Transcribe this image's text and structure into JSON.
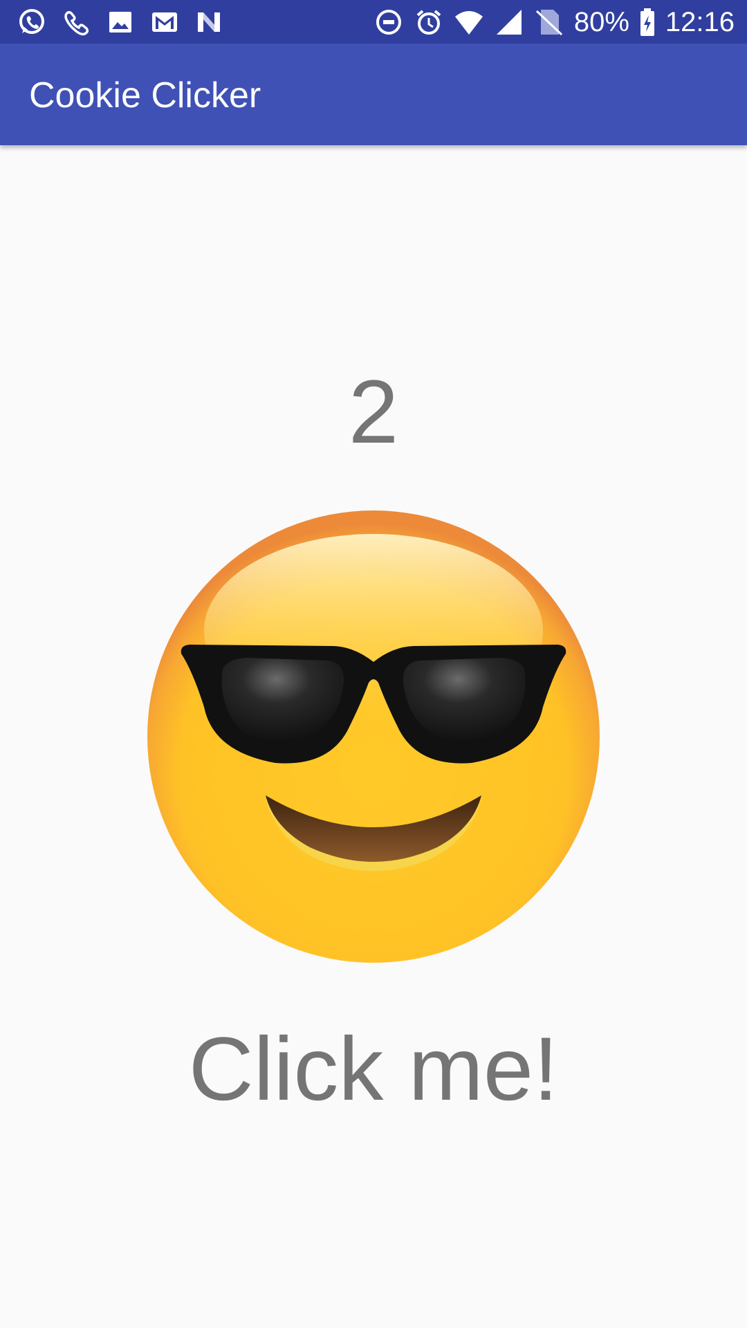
{
  "status_bar": {
    "battery": "80%",
    "time": "12:16",
    "left_icons": [
      "whatsapp-icon",
      "phone-icon",
      "image-icon",
      "gmail-icon",
      "n-app-icon"
    ],
    "right_icons": [
      "do-not-disturb-icon",
      "alarm-icon",
      "wifi-icon",
      "signal-icon",
      "no-sim-icon",
      "battery-charging-icon"
    ]
  },
  "app_bar": {
    "title": "Cookie Clicker"
  },
  "main": {
    "count": "2",
    "button_label": "Click me!",
    "emoji_icon": "smiling-face-with-sunglasses-icon"
  },
  "colors": {
    "status_bar": "#303f9f",
    "app_bar": "#3f51b5",
    "background": "#fafafa",
    "text_gray": "#757575"
  }
}
